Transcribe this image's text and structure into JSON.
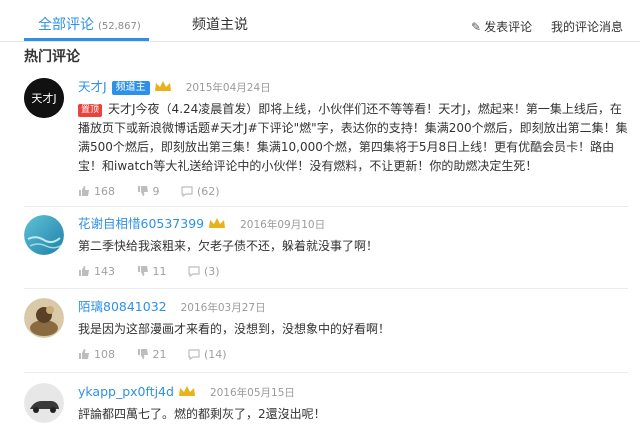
{
  "tabs": {
    "all_label": "全部评论",
    "all_count": "(52,867)",
    "host_label": "频道主说"
  },
  "actions": {
    "post_comment": "发表评论",
    "my_messages": "我的评论消息"
  },
  "section_title": "热门评论",
  "comments": [
    {
      "username": "天才J",
      "badge": "频道主",
      "avatar_text": "天才J",
      "date": "2015年04月24日",
      "tag": "置顶",
      "text": "天才J今夜（4.24凌晨首发）即将上线，小伙伴们还不等等看！天才J，燃起来！第一集上线后，在播放页下或新浪微博话题#天才J#下评论\"燃\"字，表达你的支持！集满200个燃后，即刻放出第二集！集满500个燃后，即刻放出第三集！集满10,000个燃，第四集将于5月8日上线！更有优酷会员卡！路由宝！和iwatch等大礼送给评论中的小伙伴！没有燃料，不让更新！你的助燃决定生死！",
      "likes": "168",
      "dislikes": "9",
      "replies": "(62)"
    },
    {
      "username": "花谢自相惜60537399",
      "date": "2016年09月10日",
      "text": "第二季快给我滚粗来，欠老子债不还，躲着就没事了啊！",
      "likes": "143",
      "dislikes": "11",
      "replies": "(3)"
    },
    {
      "username": "陌璃80841032",
      "date": "2016年03月27日",
      "text": "我是因为这部漫画才来看的，没想到，没想象中的好看啊！",
      "likes": "108",
      "dislikes": "21",
      "replies": "(14)"
    },
    {
      "username": "ykapp_px0ftj4d",
      "date": "2016年05月15日",
      "text": "評論都四萬七了。燃的都剩灰了，2還沒出呢！",
      "likes": "",
      "dislikes": "",
      "replies": ""
    }
  ],
  "colors": {
    "accent": "#2e91e8",
    "tag_red": "#e8433d",
    "level_gold": "#e8b21c"
  }
}
